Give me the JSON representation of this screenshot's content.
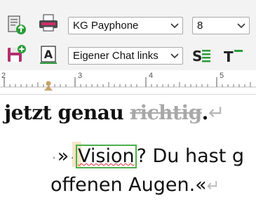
{
  "toolbar": {
    "row1": {
      "export_icon": "export-document-icon",
      "print_icon": "printer-icon",
      "font_select": {
        "value": "KG Payphone"
      },
      "size_select": {
        "value": "8"
      }
    },
    "row2": {
      "save_new_icon": "save-new-icon",
      "font_style_icon": "text-style-icon",
      "style_select": {
        "value": "Eigener Chat links"
      },
      "paragraph_style_icon": "paragraph-style-icon",
      "text_format_icon": "text-format-icon"
    }
  },
  "ruler": {
    "numbers": [
      "2",
      "3",
      "4",
      "5"
    ]
  },
  "document": {
    "line1": {
      "text": "jetzt genau",
      "struck_text": "richtig",
      "end_punct": ".",
      "para_mark": "↵"
    },
    "line2": {
      "quote_open": "»",
      "highlighted_word": "Vision",
      "rest": "? Du hast g"
    },
    "line3": {
      "text": "offenen Augen.«",
      "para_mark": "↵"
    }
  },
  "colors": {
    "toolbar_bg": "#f3f3f3",
    "accent_green": "#2a9d3a",
    "spell_error": "#e03030",
    "tracked_deletion": "#a8a8a8",
    "cursor_highlight": "#f5e6c7"
  }
}
